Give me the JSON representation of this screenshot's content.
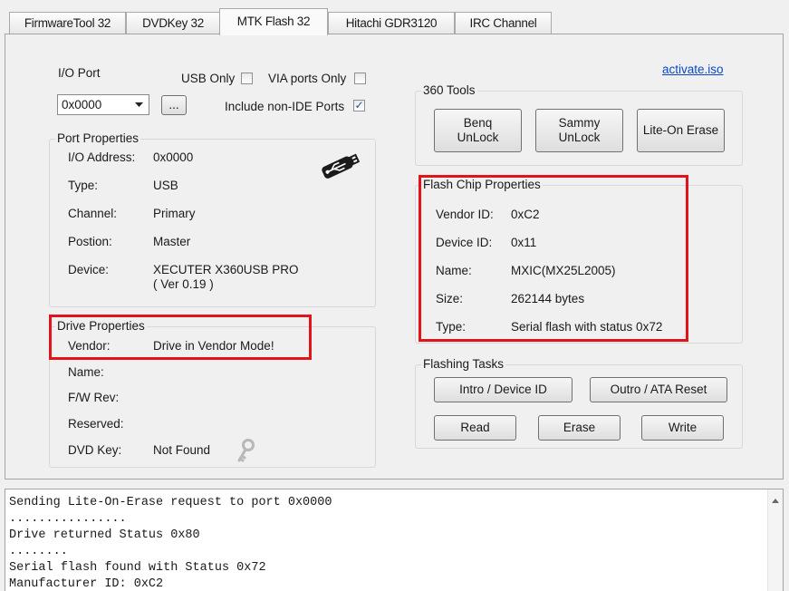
{
  "tabs": [
    "FirmwareTool 32",
    "DVDKey 32",
    "MTK Flash 32",
    "Hitachi GDR3120",
    "IRC Channel"
  ],
  "io_port": {
    "label": "I/O Port",
    "value": "0x0000",
    "browse_label": "...",
    "usb_only_label": "USB Only",
    "usb_only_checked": false,
    "via_ports_label": "VIA ports Only",
    "via_ports_checked": false,
    "non_ide_label": "Include non-IDE Ports",
    "non_ide_checked": true
  },
  "activate_link": "activate.iso",
  "port_properties": {
    "title": "Port Properties",
    "rows": [
      {
        "label": "I/O Address:",
        "value": "0x0000"
      },
      {
        "label": "Type:",
        "value": "USB"
      },
      {
        "label": "Channel:",
        "value": "Primary"
      },
      {
        "label": "Postion:",
        "value": "Master"
      },
      {
        "label": "Device:",
        "value": "XECUTER X360USB PRO",
        "value2": "( Ver 0.19 )"
      }
    ]
  },
  "drive_properties": {
    "title": "Drive Properties",
    "rows": [
      {
        "label": "Vendor:",
        "value": "Drive in Vendor Mode!"
      },
      {
        "label": "Name:",
        "value": ""
      },
      {
        "label": "F/W Rev:",
        "value": ""
      },
      {
        "label": "Reserved:",
        "value": ""
      },
      {
        "label": "DVD Key:",
        "value": "Not Found"
      }
    ]
  },
  "tools_360": {
    "title": "360 Tools",
    "benq_line1": "Benq",
    "benq_line2": "UnLock",
    "sammy_line1": "Sammy",
    "sammy_line2": "UnLock",
    "liteon": "Lite-On Erase"
  },
  "flash_chip": {
    "title": "Flash Chip Properties",
    "rows": [
      {
        "label": "Vendor ID:",
        "value": "0xC2"
      },
      {
        "label": "Device ID:",
        "value": "0x11"
      },
      {
        "label": "Name:",
        "value": "MXIC(MX25L2005)"
      },
      {
        "label": "Size:",
        "value": "262144 bytes"
      },
      {
        "label": "Type:",
        "value": "Serial flash with status 0x72"
      }
    ]
  },
  "flashing_tasks": {
    "title": "Flashing Tasks",
    "intro": "Intro / Device ID",
    "outro": "Outro / ATA Reset",
    "read": "Read",
    "erase": "Erase",
    "write": "Write"
  },
  "log_lines": [
    "Sending Lite-On-Erase request to port 0x0000",
    "................",
    "Drive returned Status 0x80",
    "........",
    "Serial flash found with Status 0x72",
    "Manufacturer ID: 0xC2"
  ],
  "colors": {
    "highlight": "#e2141b",
    "link": "#0b46c8"
  },
  "icons": {
    "usb": "usb-icon",
    "key": "key-icon",
    "scroll_up": "scroll-up-icon"
  }
}
